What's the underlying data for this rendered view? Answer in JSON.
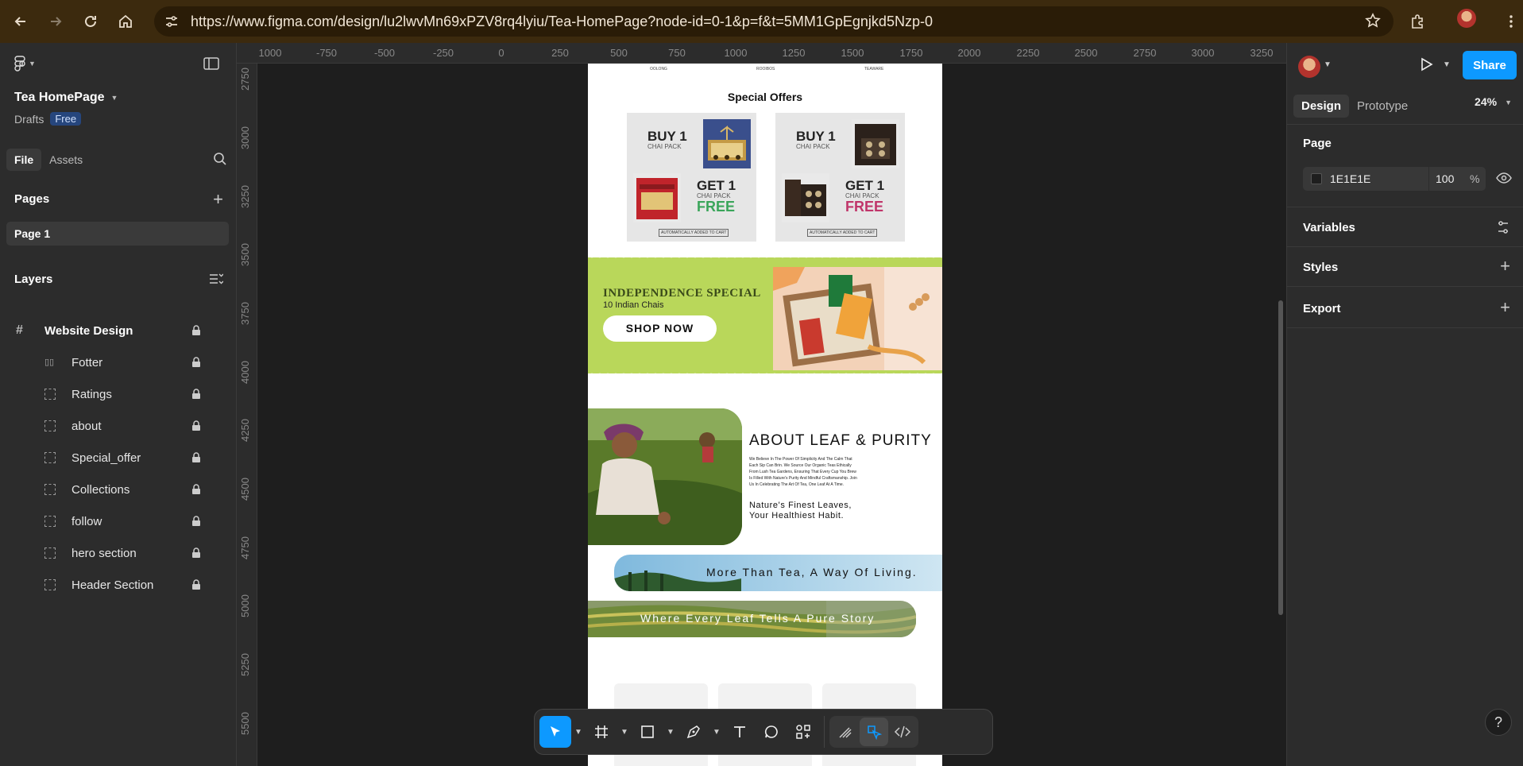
{
  "browser": {
    "url": "https://www.figma.com/design/lu2lwvMn69xPZV8rq4lyiu/Tea-HomePage?node-id=0-1&p=f&t=5MM1GpEgnjkd5Nzp-0",
    "icons": [
      "back-arrow-icon",
      "forward-arrow-icon",
      "reload-icon",
      "home-icon",
      "site-settings-icon",
      "star-icon",
      "extensions-icon",
      "profile-avatar",
      "kebab-menu-icon"
    ]
  },
  "file": {
    "title": "Tea HomePage",
    "location": "Drafts",
    "plan_badge": "Free"
  },
  "left_tabs": [
    "File",
    "Assets"
  ],
  "pages": {
    "header": "Pages",
    "items": [
      "Page 1"
    ]
  },
  "layers": {
    "header": "Layers",
    "frame": "Website Design",
    "items": [
      "Fotter",
      "Ratings",
      "about",
      "Special_offer",
      "Collections",
      "follow",
      "hero section",
      "Header Section"
    ]
  },
  "ruler": {
    "top": [
      "1000",
      "-750",
      "-500",
      "-250",
      "0",
      "250",
      "500",
      "750",
      "1000",
      "1250",
      "1500",
      "1750",
      "2000",
      "2250",
      "2500",
      "2750",
      "3000",
      "3250"
    ],
    "left": [
      "2750",
      "3000",
      "3250",
      "3500",
      "3750",
      "4000",
      "4250",
      "4500",
      "4750",
      "5000",
      "5250",
      "5500"
    ]
  },
  "design": {
    "nav_labels": [
      "OOLONG",
      "ROOIBOS",
      "TEAWARE"
    ],
    "special_offers_title": "Special Offers",
    "offers": [
      {
        "buy": "BUY 1",
        "buy_sub": "CHAI PACK",
        "get": "GET 1",
        "get_sub": "CHAI PACK",
        "free": "FREE",
        "free_color": "#3aa55a",
        "note": "AUTOMATICALLY ADDED TO CART"
      },
      {
        "buy": "BUY 1",
        "buy_sub": "CHAI PACK",
        "get": "GET 1",
        "get_sub": "CHAI PACK",
        "free": "FREE",
        "free_color": "#c0356a",
        "note": "AUTOMATICALLY ADDED TO CART"
      }
    ],
    "banner": {
      "title": "INDEPENDENCE SPECIAL",
      "subtitle": "10 Indian Chais",
      "cta": "SHOP NOW",
      "bg_color": "#b9d75a"
    },
    "about": {
      "title": "ABOUT LEAF & PURITY",
      "body": "We Believe In The Power Of Simplicity And The Calm That Each Sip Can Brin. We Source Our Organic Teas Ethically From Lush Tea Gardens, Ensuring That Every Cup You Brew Is Filled With Nature's Purity And Mindful Craftsmanship. Join Us In Celebrating The Art Of Tea, One Leaf At A Time.",
      "tagline_1": "Nature's Finest Leaves,",
      "tagline_2": "Your Healthiest Habit."
    },
    "strip_1": "More Than Tea, A Way Of Living.",
    "strip_2": "Where Every Leaf Tells A Pure Story"
  },
  "toolbar": {
    "tools": [
      "move-tool",
      "frame-tool",
      "shape-tool",
      "pen-tool",
      "text-tool",
      "comment-tool",
      "actions-tool"
    ],
    "modes": [
      "draw-mode",
      "design-mode",
      "dev-mode"
    ]
  },
  "right_panel": {
    "share_label": "Share",
    "tabs": [
      "Design",
      "Prototype"
    ],
    "zoom": "24%",
    "page_section": "Page",
    "page_color_hex": "1E1E1E",
    "page_opacity": "100",
    "percent_sign": "%",
    "variables": "Variables",
    "styles": "Styles",
    "export": "Export",
    "help": "?"
  },
  "colors": {
    "accent": "#0d99ff",
    "panel_bg": "#2c2c2c",
    "canvas_bg": "#1e1e1e",
    "browser_bar": "#3c2a0e"
  }
}
